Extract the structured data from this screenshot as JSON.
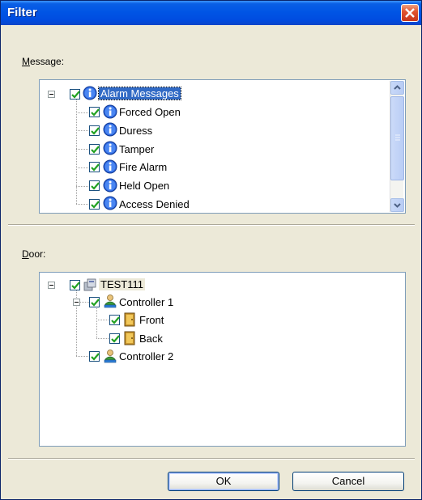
{
  "window": {
    "title": "Filter"
  },
  "message": {
    "label_underlined": "M",
    "label_rest": "essage:",
    "root": "Alarm Messages",
    "items": [
      "Forced Open",
      "Duress",
      "Tamper",
      "Fire Alarm",
      "Held Open",
      "Access Denied"
    ]
  },
  "door": {
    "label_underlined": "D",
    "label_rest": "oor:",
    "root": "TEST111",
    "controllers": [
      {
        "name": "Controller 1",
        "doors": [
          "Front",
          "Back"
        ]
      },
      {
        "name": "Controller 2",
        "doors": []
      }
    ]
  },
  "buttons": {
    "ok": "OK",
    "cancel": "Cancel"
  },
  "colors": {
    "titlebar": "#0055e5",
    "selection": "#316ac5",
    "dialog_bg": "#ece9d8"
  }
}
